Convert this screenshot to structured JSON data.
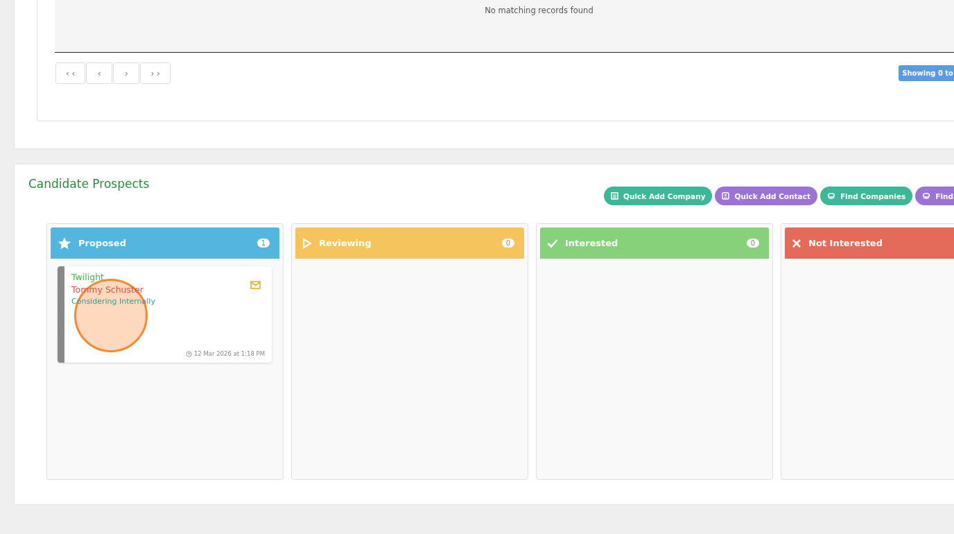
{
  "records_table": {
    "empty_message": "No matching records found",
    "pager": [
      "‹ ‹",
      "‹",
      "›",
      "› ›"
    ],
    "showing": "Showing 0 to"
  },
  "prospects": {
    "title": "Candidate Prospects",
    "actions": [
      {
        "label": "Quick Add Company",
        "kind": "company",
        "color": "#3cb896"
      },
      {
        "label": "Quick Add Contact",
        "kind": "contact",
        "color": "#9b72d6"
      },
      {
        "label": "Find Companies",
        "kind": "find",
        "color": "#3cb896"
      },
      {
        "label": "Find",
        "kind": "find",
        "color": "#9b72d6"
      }
    ],
    "columns": [
      {
        "title": "Proposed",
        "kind": "star",
        "color": "#52b6de",
        "count": "1",
        "cards": [
          {
            "company": "Twilight",
            "contact": "Tommy Schuster",
            "status": "Considering Internally",
            "date": "12 Mar 2026 at 1:18 PM"
          }
        ]
      },
      {
        "title": "Reviewing",
        "kind": "play",
        "color": "#f6c45c",
        "count": "0"
      },
      {
        "title": "Interested",
        "kind": "check",
        "color": "#86d17a",
        "count": "0"
      },
      {
        "title": "Not Interested",
        "kind": "cross",
        "color": "#e46a5a"
      }
    ]
  }
}
